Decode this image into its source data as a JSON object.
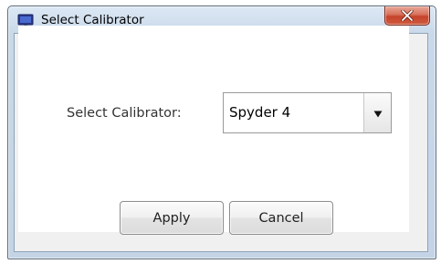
{
  "window": {
    "title": "Select Calibrator",
    "title_icon": "monitor-icon",
    "close_icon": "close-icon"
  },
  "form": {
    "calibrator_label": "Select Calibrator:",
    "calibrator_value": "Spyder 4",
    "dropdown_icon": "triangle-down-icon"
  },
  "buttons": {
    "apply": "Apply",
    "cancel": "Cancel"
  },
  "colors": {
    "titlebar": "#c9d9ea",
    "close_button": "#c5432a",
    "content_background": "#ffffff",
    "button_border": "#8c8c8c"
  }
}
